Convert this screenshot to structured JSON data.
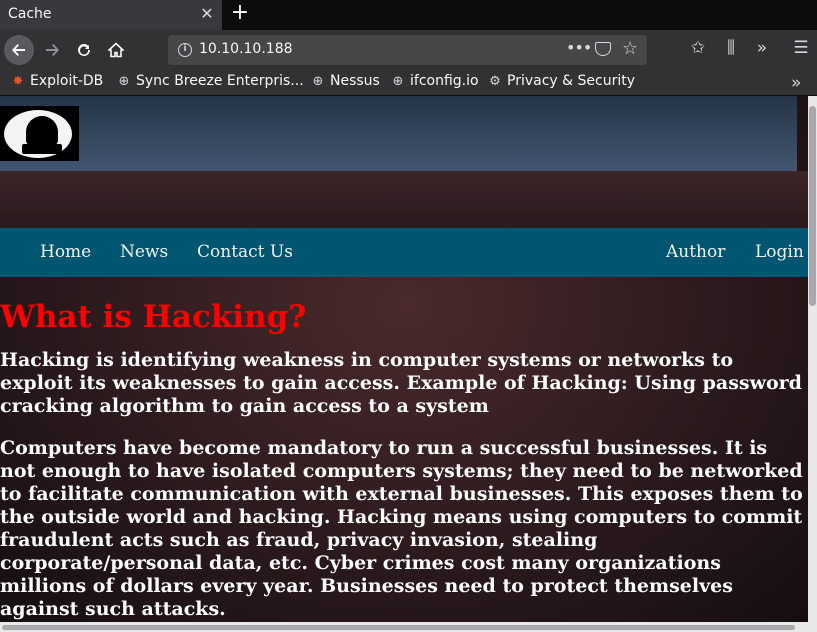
{
  "browser": {
    "tab": {
      "title": "Cache",
      "close_glyph": "✕"
    },
    "new_tab_glyph": "+",
    "url": "10.10.10.188",
    "toolbar_icons": [
      "back-icon",
      "forward-icon",
      "reload-icon",
      "home-icon",
      "info-icon",
      "page-actions-icon",
      "pocket-icon",
      "star-icon",
      "library-icon",
      "sidebar-icon",
      "overflow-icon",
      "menu-icon"
    ],
    "bookmarks": [
      {
        "label": "Exploit-DB",
        "icon": "exploit-db-icon"
      },
      {
        "label": "Sync Breeze Enterpris...",
        "icon": "globe-icon"
      },
      {
        "label": "Nessus",
        "icon": "globe-icon"
      },
      {
        "label": "ifconfig.io",
        "icon": "globe-icon"
      },
      {
        "label": "Privacy & Security",
        "icon": "gear-icon"
      }
    ]
  },
  "site": {
    "nav": {
      "home": "Home",
      "news": "News",
      "contact": "Contact Us",
      "author": "Author",
      "login": "Login"
    },
    "heading": "What is Hacking?",
    "paragraphs": [
      "Hacking is identifying weakness in computer systems or networks to exploit its weaknesses to gain access. Example of Hacking: Using password cracking algorithm to gain access to a system",
      "Computers have become mandatory to run a successful businesses. It is not enough to have isolated computers systems; they need to be networked to facilitate communication with external businesses. This exposes them to the outside world and hacking. Hacking means using computers to commit fraudulent acts such as fraud, privacy invasion, stealing corporate/personal data, etc. Cyber crimes cost many organizations millions of dollars every year. Businesses need to protect themselves against such attacks."
    ],
    "colors": {
      "heading": "#ff0000",
      "nav_bar": "#005670",
      "text": "#ffffff"
    }
  }
}
